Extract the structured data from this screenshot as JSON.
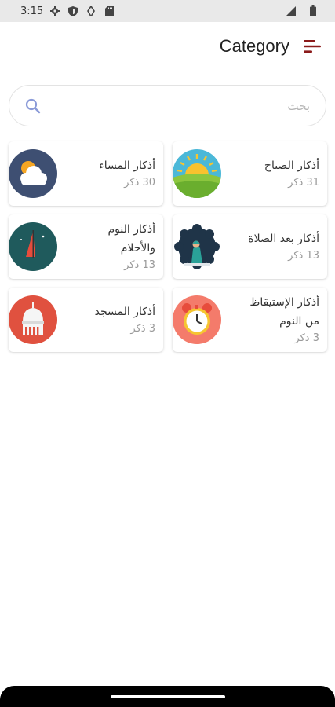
{
  "status_bar": {
    "time": "3:15",
    "icons": [
      "gear-icon",
      "shield-icon",
      "vpn-key-icon",
      "sd-card-icon"
    ],
    "right_icons": [
      "signal-icon",
      "battery-icon"
    ]
  },
  "app_bar": {
    "title": "Category",
    "menu_icon": "menu-icon",
    "accent": "#8b1a1a"
  },
  "search": {
    "placeholder": "بحث",
    "value": ""
  },
  "categories": [
    {
      "title": "أذكار الصباح",
      "count": "31 ذكر",
      "icon": "sunrise-icon"
    },
    {
      "title": "أذكار المساء",
      "count": "30 ذكر",
      "icon": "cloud-sun-icon"
    },
    {
      "title": "أذكار بعد الصلاة",
      "count": "13 ذكر",
      "icon": "praying-person-icon"
    },
    {
      "title": "أذكار النوم والأحلام",
      "count": "13 ذكر",
      "icon": "moon-night-icon"
    },
    {
      "title": "أذكار الإستيقاظ من النوم",
      "count": "3 ذكر",
      "icon": "alarm-clock-icon"
    },
    {
      "title": "أذكار المسجد",
      "count": "3 ذكر",
      "icon": "mosque-icon"
    }
  ]
}
